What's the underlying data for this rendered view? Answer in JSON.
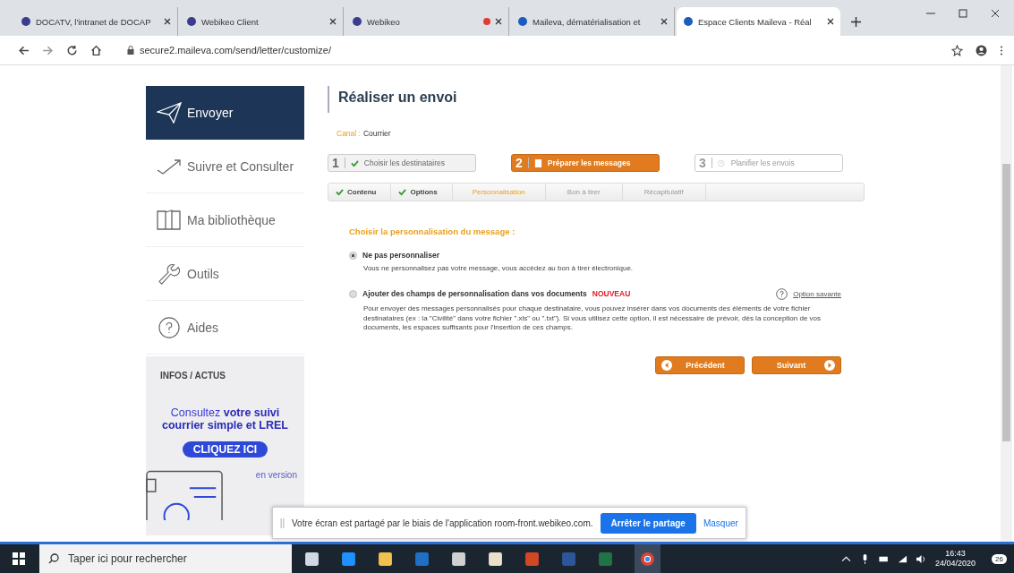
{
  "browser": {
    "tabs": [
      {
        "title": "DOCATV, l'intranet de DOCAP",
        "selected": false,
        "recording": false
      },
      {
        "title": "Webikeo Client",
        "selected": false,
        "recording": false
      },
      {
        "title": "Webikeo",
        "selected": false,
        "recording": true
      },
      {
        "title": "Maileva, dématérialisation et",
        "selected": false,
        "recording": false
      },
      {
        "title": "Espace Clients Maileva - Réal",
        "selected": true,
        "recording": false
      }
    ],
    "address": "secure2.maileva.com/send/letter/customize/"
  },
  "sidebar": {
    "items": [
      {
        "label": "Envoyer",
        "selected": true
      },
      {
        "label": "Suivre et Consulter",
        "selected": false
      },
      {
        "label": "Ma bibliothèque",
        "selected": false
      },
      {
        "label": "Outils",
        "selected": false
      },
      {
        "label": "Aides",
        "selected": false
      }
    ],
    "news": {
      "heading": "INFOS / ACTUS",
      "text": "Consultez **votre suivi courrier simple et LREL**",
      "button": "CLIQUEZ ICI",
      "footer": "en version"
    }
  },
  "main": {
    "title": "Réaliser un envoi",
    "channel_label": "Canal :",
    "channel_value": "Courrier",
    "steps": [
      {
        "number": "1",
        "label": "Choisir les destinataires",
        "done": true,
        "selected": false
      },
      {
        "number": "2",
        "label": "Préparer les messages",
        "done": false,
        "selected": true
      },
      {
        "number": "3",
        "label": "Planifier les envois",
        "done": false,
        "selected": false
      }
    ],
    "substeps": [
      {
        "label": "Contenu",
        "done": true,
        "selected": false
      },
      {
        "label": "Options",
        "done": true,
        "selected": false
      },
      {
        "label": "Personnalisation",
        "done": false,
        "selected": true
      },
      {
        "label": "Bon à tirer",
        "done": false,
        "selected": false
      },
      {
        "label": "Récapitulatif",
        "done": false,
        "selected": false
      }
    ],
    "section_title": "Choisir la personnalisation du message :",
    "options": [
      {
        "label": "Ne pas personnaliser",
        "description": "Vous ne personnalisez pas votre message, vous accédez au bon à tirer électronique.",
        "selected": true
      },
      {
        "label": "Ajouter des champs de personnalisation dans vos documents",
        "badge": "NOUVEAU",
        "description": "Pour envoyer des messages personnalisés pour chaque destinataire, vous pouvez insérer dans vos documents des éléments de votre fichier destinataires (ex : la \"Civilité\" dans votre fichier \".xls\" ou \".txt\"). Si vous utilisez cette option, il est nécessaire de prévoir, dès la conception de vos documents, les espaces suffisants pour l'insertion de ces champs.",
        "selected": false,
        "help_link": "Option savante"
      }
    ],
    "prev_button": "Précédent",
    "next_button": "Suivant"
  },
  "share_bar": {
    "text": "Votre écran est partagé par le biais de l'application room-front.webikeo.com.",
    "button": "Arrêter le partage",
    "link": "Masquer"
  },
  "taskbar": {
    "search_placeholder": "Taper ici pour rechercher",
    "time": "16:43",
    "date": "24/04/2020",
    "notifications": "26"
  }
}
